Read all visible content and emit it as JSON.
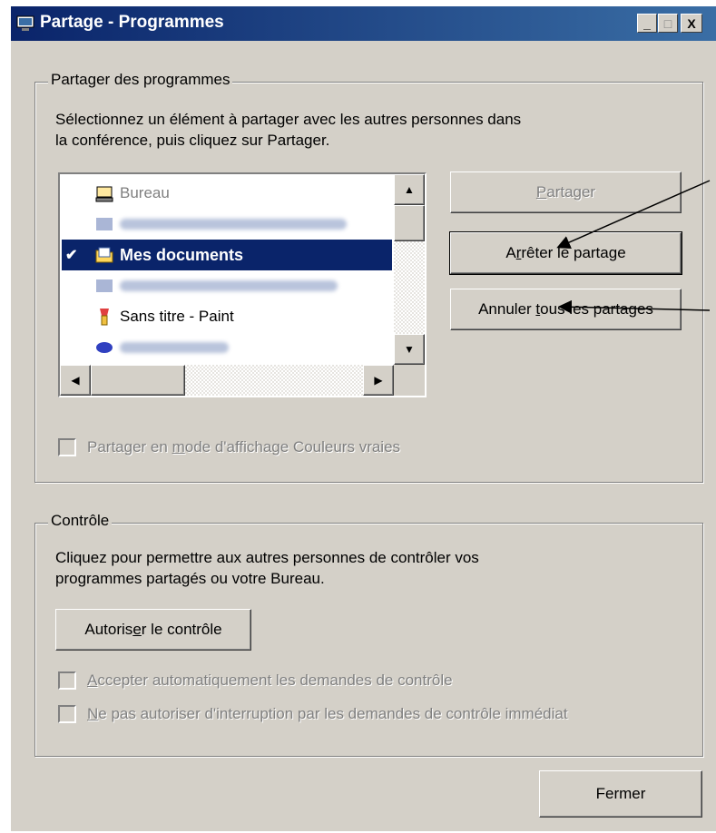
{
  "window": {
    "title": "Partage - Programmes",
    "controls": {
      "minimize": "_",
      "maximize": "□",
      "close": "X"
    }
  },
  "share_group": {
    "legend": "Partager des programmes",
    "instructions_line1": "Sélectionnez un élément à partager avec les autres personnes dans",
    "instructions_line2": "la conférence, puis cliquez sur Partager.",
    "list_items": [
      {
        "label": "Bureau",
        "icon": "desktop-icon",
        "state": "dim"
      },
      {
        "label": "",
        "icon": "window-icon",
        "state": "blurred"
      },
      {
        "label": "Mes documents",
        "icon": "folder-icon",
        "state": "selected",
        "checked": "✔"
      },
      {
        "label": "",
        "icon": "window-icon",
        "state": "blurred"
      },
      {
        "label": "Sans titre - Paint",
        "icon": "paint-icon",
        "state": "normal"
      },
      {
        "label": "",
        "icon": "app-icon",
        "state": "blurred"
      }
    ],
    "buttons": {
      "share": {
        "pre": "",
        "ul": "P",
        "post": "artager",
        "enabled": false
      },
      "stop_share": {
        "pre": "A",
        "ul": "r",
        "post": "rêter le partage",
        "enabled": true
      },
      "cancel_all": {
        "pre": "Annuler ",
        "ul": "t",
        "post": "ous les partages",
        "enabled": true
      }
    },
    "true_color": {
      "pre": "Partager en ",
      "ul": "m",
      "post": "ode d'affichage Couleurs vraies",
      "checked": false,
      "enabled": false
    }
  },
  "control_group": {
    "legend": "Contrôle",
    "instructions_line1": "Cliquez pour permettre aux autres personnes de contrôler vos",
    "instructions_line2": "programmes partagés ou votre Bureau.",
    "allow_button": {
      "pre": "Autoris",
      "ul": "e",
      "post": "r le contrôle"
    },
    "auto_accept": {
      "pre": "",
      "ul": "A",
      "post": "ccepter automatiquement les demandes de contrôle",
      "enabled": false
    },
    "no_interrupt": {
      "pre": "",
      "ul": "N",
      "post": "e pas autoriser d'interruption par les demandes de contrôle immédiat",
      "enabled": false
    }
  },
  "footer": {
    "close_label": "Fermer"
  }
}
